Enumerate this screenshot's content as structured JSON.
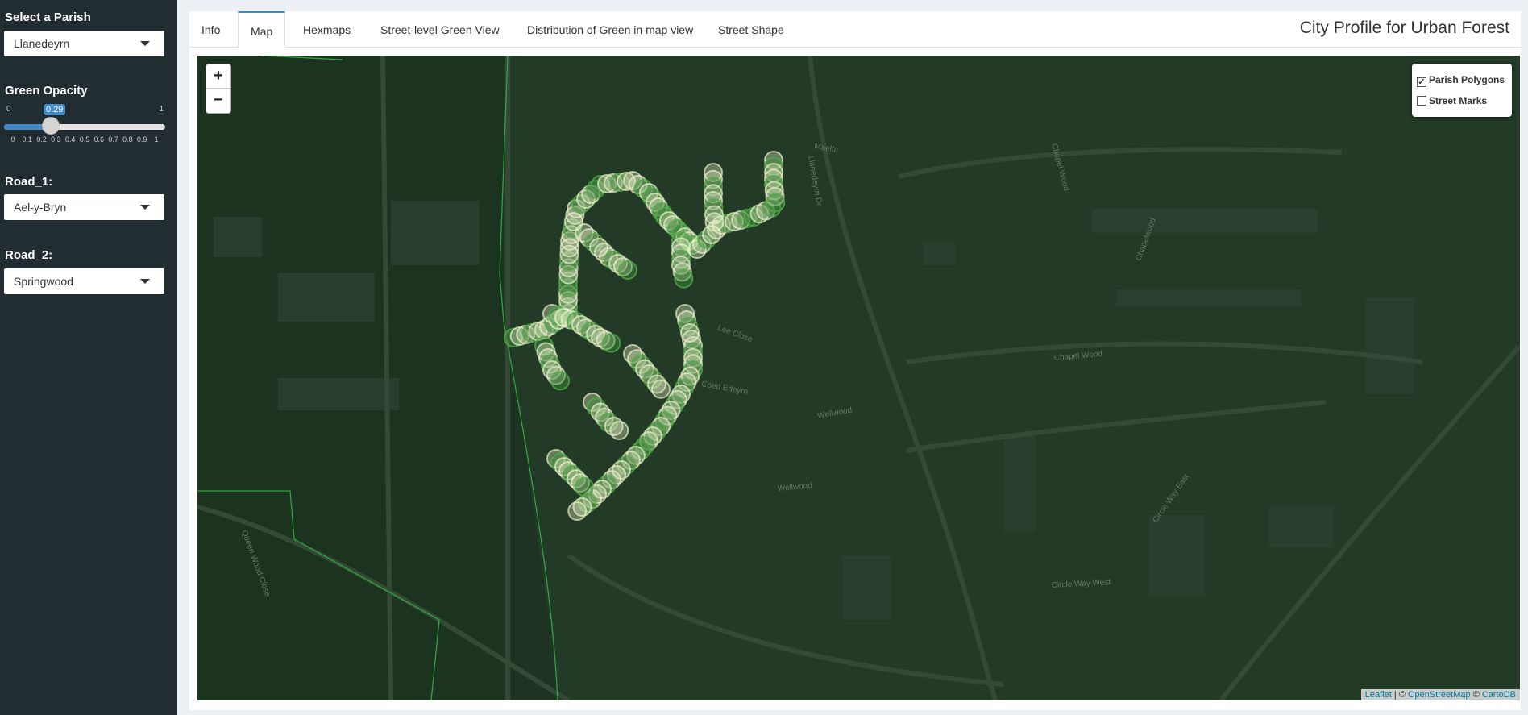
{
  "sidebar": {
    "parish_label": "Select a Parish",
    "parish_value": "Llanedeyrn",
    "opacity_label": "Green Opacity",
    "opacity": {
      "min": "0",
      "max": "1",
      "value": 0.29,
      "value_label": "0.29",
      "ticks": [
        "0",
        "0.1",
        "0.2",
        "0.3",
        "0.4",
        "0.5",
        "0.6",
        "0.7",
        "0.8",
        "0.9",
        "1"
      ]
    },
    "road1_label": "Road_1:",
    "road1_value": "Ael-y-Bryn",
    "road2_label": "Road_2:",
    "road2_value": "Springwood"
  },
  "tabs": [
    "Info",
    "Map",
    "Hexmaps",
    "Street-level Green View",
    "Distribution of Green in map view",
    "Street Shape"
  ],
  "active_tab": "Map",
  "title": "City Profile for Urban Forest",
  "map": {
    "zoom_in": "+",
    "zoom_out": "−",
    "layers": [
      {
        "label": "Parish Polygons",
        "checked": true
      },
      {
        "label": "Street Marks",
        "checked": false
      }
    ],
    "street_labels": [
      "Llanedeyrn Dr",
      "Chapel Wood",
      "Chapel Wood",
      "Coed Edeyrn",
      "Wellwood",
      "Wellwood",
      "Circle Way East",
      "Circle Way West",
      "Maelfa",
      "Lee Close",
      "Queen Wood Close",
      "Chapelwood"
    ],
    "attribution": {
      "leaflet": "Leaflet",
      "sep1": " | © ",
      "osm": "OpenStreetMap",
      "sep2": " © ",
      "carto": "CartoDB"
    }
  },
  "colors": {
    "sidebar": "#222d32",
    "map_bg": "#1f3322",
    "accent": "#3c8dbc",
    "marker_light": "#e8f3c8",
    "marker_dark": "#3f8f3a"
  }
}
